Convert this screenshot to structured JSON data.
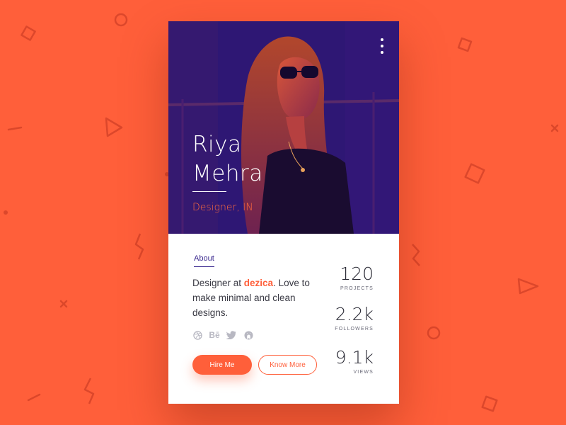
{
  "profile": {
    "first_name": "Riya",
    "last_name": "Mehra",
    "title": "Designer, IN"
  },
  "menu": {
    "icon": "more-vertical-icon"
  },
  "about": {
    "tab_label": "About",
    "bio_prefix": "Designer at ",
    "bio_brand": "dezica",
    "bio_suffix": ". Love to make minimal and clean designs."
  },
  "socials": [
    {
      "icon": "dribbble-icon"
    },
    {
      "icon": "behance-icon",
      "glyph": "Bē"
    },
    {
      "icon": "twitter-icon"
    },
    {
      "icon": "github-icon"
    }
  ],
  "actions": {
    "hire_label": "Hire Me",
    "know_more_label": "Know More"
  },
  "stats": [
    {
      "value": "120",
      "label": "PROJECTS"
    },
    {
      "value": "2.2k",
      "label": "FOLLOWERS"
    },
    {
      "value": "9.1k",
      "label": "VIEWS"
    }
  ],
  "colors": {
    "background": "#ff5f3a",
    "accent": "#ff5f3a",
    "hero_purple": "#2d1677",
    "about_tab": "#3b2a8f"
  }
}
